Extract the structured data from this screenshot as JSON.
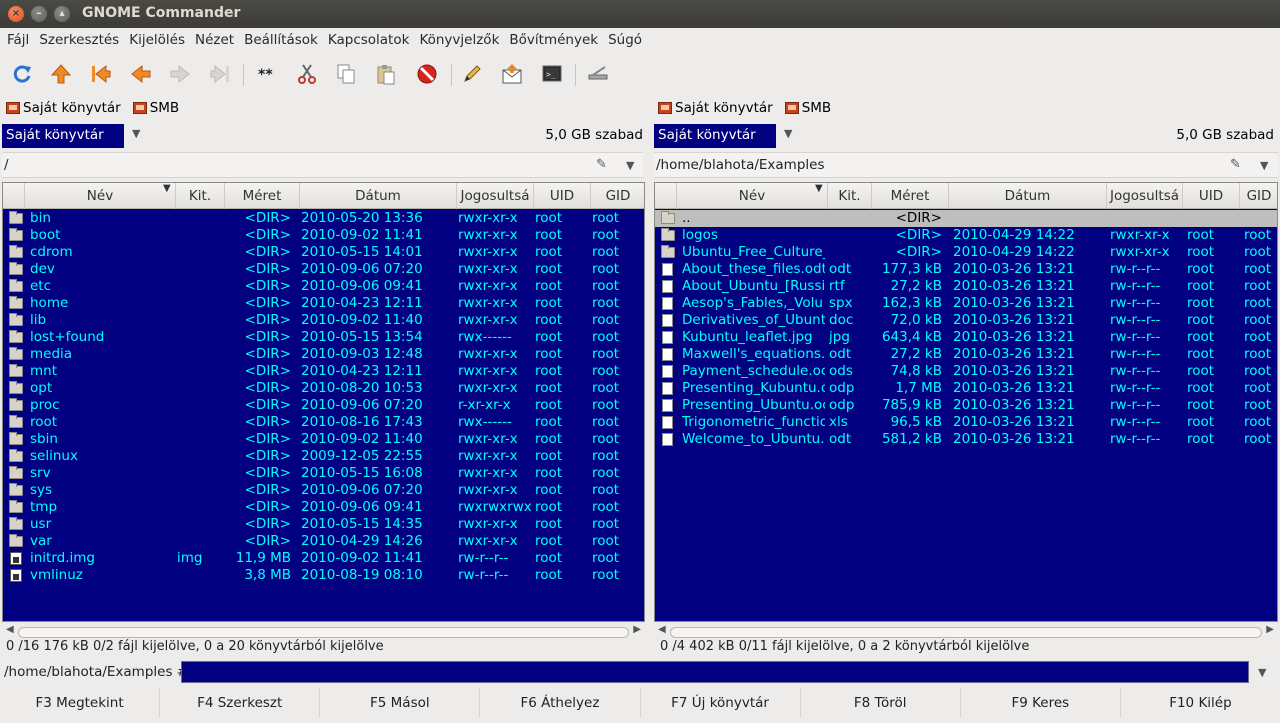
{
  "window": {
    "title": "GNOME Commander"
  },
  "menu": [
    "Fájl",
    "Szerkesztés",
    "Kijelölés",
    "Nézet",
    "Beállítások",
    "Kapcsolatok",
    "Könyvjelzők",
    "Bővítmények",
    "Súgó"
  ],
  "toolbar_icons": [
    "refresh-icon",
    "up-icon",
    "first-icon",
    "back-icon",
    "forward-icon",
    "last-icon",
    "copy-names-icon",
    "cut-icon",
    "copy-icon",
    "paste-icon",
    "delete-icon",
    "edit-icon",
    "email-icon",
    "terminal-icon",
    "connection-icon"
  ],
  "colors": {
    "list_bg": "#000080",
    "list_fg": "#00ffff",
    "selected_bg": "#bebebe"
  },
  "left": {
    "devices": [
      "Saját könyvtár",
      "SMB"
    ],
    "volume": "Saját könyvtár",
    "free": "5,0 GB szabad",
    "path": "/",
    "columns": [
      "Név",
      "Kit.",
      "Méret",
      "Dátum",
      "Jogosultsá",
      "UID",
      "GID"
    ],
    "rows": [
      {
        "icon": "dir",
        "name": "bin",
        "ext": "",
        "size": "<DIR>",
        "date": "2010-05-20 13:36",
        "perm": "rwxr-xr-x",
        "uid": "root",
        "gid": "root"
      },
      {
        "icon": "dir",
        "name": "boot",
        "ext": "",
        "size": "<DIR>",
        "date": "2010-09-02 11:41",
        "perm": "rwxr-xr-x",
        "uid": "root",
        "gid": "root"
      },
      {
        "icon": "dir",
        "name": "cdrom",
        "ext": "",
        "size": "<DIR>",
        "date": "2010-05-15 14:01",
        "perm": "rwxr-xr-x",
        "uid": "root",
        "gid": "root"
      },
      {
        "icon": "dir",
        "name": "dev",
        "ext": "",
        "size": "<DIR>",
        "date": "2010-09-06 07:20",
        "perm": "rwxr-xr-x",
        "uid": "root",
        "gid": "root"
      },
      {
        "icon": "dir",
        "name": "etc",
        "ext": "",
        "size": "<DIR>",
        "date": "2010-09-06 09:41",
        "perm": "rwxr-xr-x",
        "uid": "root",
        "gid": "root"
      },
      {
        "icon": "dir",
        "name": "home",
        "ext": "",
        "size": "<DIR>",
        "date": "2010-04-23 12:11",
        "perm": "rwxr-xr-x",
        "uid": "root",
        "gid": "root"
      },
      {
        "icon": "dir",
        "name": "lib",
        "ext": "",
        "size": "<DIR>",
        "date": "2010-09-02 11:40",
        "perm": "rwxr-xr-x",
        "uid": "root",
        "gid": "root"
      },
      {
        "icon": "dir",
        "name": "lost+found",
        "ext": "",
        "size": "<DIR>",
        "date": "2010-05-15 13:54",
        "perm": "rwx------",
        "uid": "root",
        "gid": "root"
      },
      {
        "icon": "dir",
        "name": "media",
        "ext": "",
        "size": "<DIR>",
        "date": "2010-09-03 12:48",
        "perm": "rwxr-xr-x",
        "uid": "root",
        "gid": "root"
      },
      {
        "icon": "dir",
        "name": "mnt",
        "ext": "",
        "size": "<DIR>",
        "date": "2010-04-23 12:11",
        "perm": "rwxr-xr-x",
        "uid": "root",
        "gid": "root"
      },
      {
        "icon": "dir",
        "name": "opt",
        "ext": "",
        "size": "<DIR>",
        "date": "2010-08-20 10:53",
        "perm": "rwxr-xr-x",
        "uid": "root",
        "gid": "root"
      },
      {
        "icon": "dir",
        "name": "proc",
        "ext": "",
        "size": "<DIR>",
        "date": "2010-09-06 07:20",
        "perm": "r-xr-xr-x",
        "uid": "root",
        "gid": "root"
      },
      {
        "icon": "dir",
        "name": "root",
        "ext": "",
        "size": "<DIR>",
        "date": "2010-08-16 17:43",
        "perm": "rwx------",
        "uid": "root",
        "gid": "root"
      },
      {
        "icon": "dir",
        "name": "sbin",
        "ext": "",
        "size": "<DIR>",
        "date": "2010-09-02 11:40",
        "perm": "rwxr-xr-x",
        "uid": "root",
        "gid": "root"
      },
      {
        "icon": "dir",
        "name": "selinux",
        "ext": "",
        "size": "<DIR>",
        "date": "2009-12-05 22:55",
        "perm": "rwxr-xr-x",
        "uid": "root",
        "gid": "root"
      },
      {
        "icon": "dir",
        "name": "srv",
        "ext": "",
        "size": "<DIR>",
        "date": "2010-05-15 16:08",
        "perm": "rwxr-xr-x",
        "uid": "root",
        "gid": "root"
      },
      {
        "icon": "dir",
        "name": "sys",
        "ext": "",
        "size": "<DIR>",
        "date": "2010-09-06 07:20",
        "perm": "rwxr-xr-x",
        "uid": "root",
        "gid": "root"
      },
      {
        "icon": "dir",
        "name": "tmp",
        "ext": "",
        "size": "<DIR>",
        "date": "2010-09-06 09:41",
        "perm": "rwxrwxrwx",
        "uid": "root",
        "gid": "root"
      },
      {
        "icon": "dir",
        "name": "usr",
        "ext": "",
        "size": "<DIR>",
        "date": "2010-05-15 14:35",
        "perm": "rwxr-xr-x",
        "uid": "root",
        "gid": "root"
      },
      {
        "icon": "dir",
        "name": "var",
        "ext": "",
        "size": "<DIR>",
        "date": "2010-04-29 14:26",
        "perm": "rwxr-xr-x",
        "uid": "root",
        "gid": "root"
      },
      {
        "icon": "exe",
        "name": "initrd.img",
        "ext": "img",
        "size": "11,9 MB",
        "date": "2010-09-02 11:41",
        "perm": "rw-r--r--",
        "uid": "root",
        "gid": "root"
      },
      {
        "icon": "exe",
        "name": "vmlinuz",
        "ext": "",
        "size": "3,8 MB",
        "date": "2010-08-19 08:10",
        "perm": "rw-r--r--",
        "uid": "root",
        "gid": "root"
      }
    ],
    "status": "0 /16 176  kB 0/2 fájl kijelölve, 0 a 20 könyvtárból kijelölve"
  },
  "right": {
    "devices": [
      "Saját könyvtár",
      "SMB"
    ],
    "volume": "Saját könyvtár",
    "free": "5,0 GB szabad",
    "path": "/home/blahota/Examples",
    "columns": [
      "Név",
      "Kit.",
      "Méret",
      "Dátum",
      "Jogosultsá",
      "UID",
      "GID"
    ],
    "rows": [
      {
        "icon": "dir",
        "name": "..",
        "ext": "",
        "size": "<DIR>",
        "date": "",
        "perm": "",
        "uid": "",
        "gid": "",
        "selected": true
      },
      {
        "icon": "dir",
        "name": "logos",
        "ext": "",
        "size": "<DIR>",
        "date": "2010-04-29 14:22",
        "perm": "rwxr-xr-x",
        "uid": "root",
        "gid": "root"
      },
      {
        "icon": "dir",
        "name": "Ubuntu_Free_Culture_",
        "ext": "",
        "size": "<DIR>",
        "date": "2010-04-29 14:22",
        "perm": "rwxr-xr-x",
        "uid": "root",
        "gid": "root"
      },
      {
        "icon": "doc",
        "name": "About_these_files.odt",
        "ext": "odt",
        "size": "177,3 kB",
        "date": "2010-03-26 13:21",
        "perm": "rw-r--r--",
        "uid": "root",
        "gid": "root"
      },
      {
        "icon": "doc",
        "name": "About_Ubuntu_[Russia",
        "ext": "rtf",
        "size": "27,2 kB",
        "date": "2010-03-26 13:21",
        "perm": "rw-r--r--",
        "uid": "root",
        "gid": "root"
      },
      {
        "icon": "doc",
        "name": "Aesop's_Fables,_Volu",
        "ext": "spx",
        "size": "162,3 kB",
        "date": "2010-03-26 13:21",
        "perm": "rw-r--r--",
        "uid": "root",
        "gid": "root"
      },
      {
        "icon": "doc",
        "name": "Derivatives_of_Ubunt",
        "ext": "doc",
        "size": "72,0 kB",
        "date": "2010-03-26 13:21",
        "perm": "rw-r--r--",
        "uid": "root",
        "gid": "root"
      },
      {
        "icon": "doc",
        "name": "Kubuntu_leaflet.jpg",
        "ext": "jpg",
        "size": "643,4 kB",
        "date": "2010-03-26 13:21",
        "perm": "rw-r--r--",
        "uid": "root",
        "gid": "root"
      },
      {
        "icon": "doc",
        "name": "Maxwell's_equations.",
        "ext": "odt",
        "size": "27,2 kB",
        "date": "2010-03-26 13:21",
        "perm": "rw-r--r--",
        "uid": "root",
        "gid": "root"
      },
      {
        "icon": "doc",
        "name": "Payment_schedule.oc",
        "ext": "ods",
        "size": "74,8 kB",
        "date": "2010-03-26 13:21",
        "perm": "rw-r--r--",
        "uid": "root",
        "gid": "root"
      },
      {
        "icon": "doc",
        "name": "Presenting_Kubuntu.o",
        "ext": "odp",
        "size": "1,7 MB",
        "date": "2010-03-26 13:21",
        "perm": "rw-r--r--",
        "uid": "root",
        "gid": "root"
      },
      {
        "icon": "doc",
        "name": "Presenting_Ubuntu.oc",
        "ext": "odp",
        "size": "785,9 kB",
        "date": "2010-03-26 13:21",
        "perm": "rw-r--r--",
        "uid": "root",
        "gid": "root"
      },
      {
        "icon": "doc",
        "name": "Trigonometric_functio",
        "ext": "xls",
        "size": "96,5 kB",
        "date": "2010-03-26 13:21",
        "perm": "rw-r--r--",
        "uid": "root",
        "gid": "root"
      },
      {
        "icon": "doc",
        "name": "Welcome_to_Ubuntu.c",
        "ext": "odt",
        "size": "581,2 kB",
        "date": "2010-03-26 13:21",
        "perm": "rw-r--r--",
        "uid": "root",
        "gid": "root"
      }
    ],
    "status": "0 /4 402  kB 0/11 fájl kijelölve, 0 a 2 könyvtárból kijelölve"
  },
  "command": {
    "prompt": "/home/blahota/Examples #",
    "value": ""
  },
  "fkeys": [
    "F3 Megtekint",
    "F4 Szerkeszt",
    "F5 Másol",
    "F6 Áthelyez",
    "F7 Új könyvtár",
    "F8 Töröl",
    "F9 Keres",
    "F10 Kilép"
  ]
}
